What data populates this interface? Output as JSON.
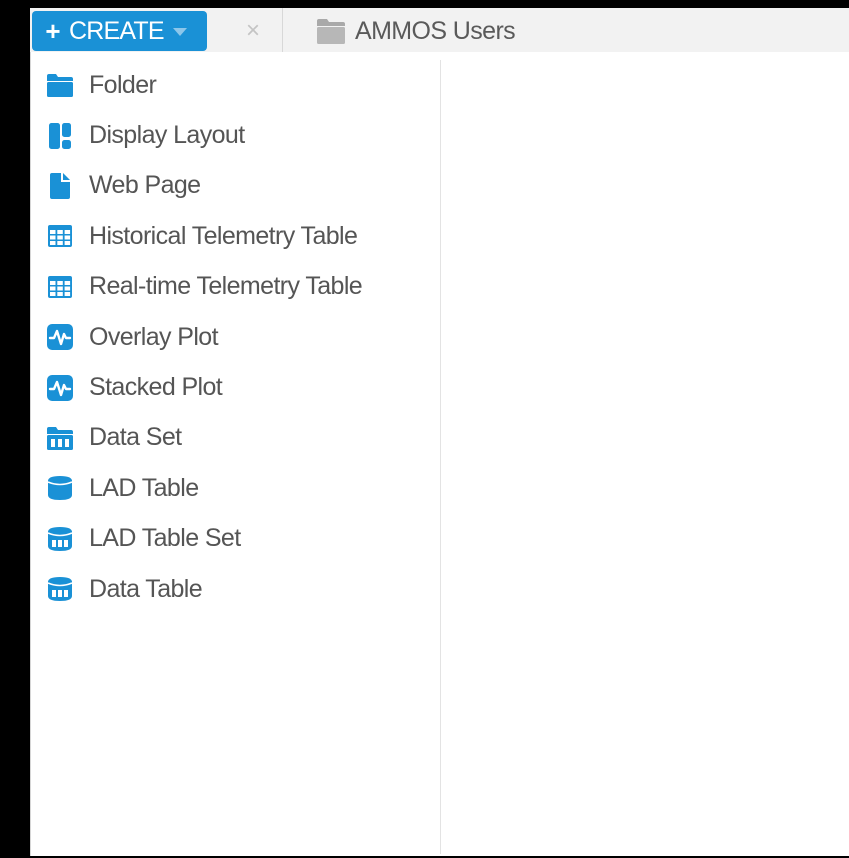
{
  "colors": {
    "accent": "#1a91d6",
    "icon": "#1a91d6",
    "text": "#555555"
  },
  "toolbar": {
    "create_plus": "+",
    "create_label": "CREATE",
    "close_glyph": "×",
    "close_icon": "close-icon",
    "breadcrumb": {
      "icon": "folder-icon",
      "label": "AMMOS Users"
    }
  },
  "menu": {
    "items": [
      {
        "label": "Folder",
        "icon": "folder-icon"
      },
      {
        "label": "Display Layout",
        "icon": "layout-icon"
      },
      {
        "label": "Web Page",
        "icon": "page-icon"
      },
      {
        "label": "Historical Telemetry Table",
        "icon": "table-icon"
      },
      {
        "label": "Real-time Telemetry Table",
        "icon": "table-icon"
      },
      {
        "label": "Overlay Plot",
        "icon": "plot-icon"
      },
      {
        "label": "Stacked Plot",
        "icon": "plot-icon"
      },
      {
        "label": "Data Set",
        "icon": "dataset-icon"
      },
      {
        "label": "LAD Table",
        "icon": "database-icon"
      },
      {
        "label": "LAD Table Set",
        "icon": "database-set-icon"
      },
      {
        "label": "Data Table",
        "icon": "database-set-icon"
      }
    ]
  }
}
